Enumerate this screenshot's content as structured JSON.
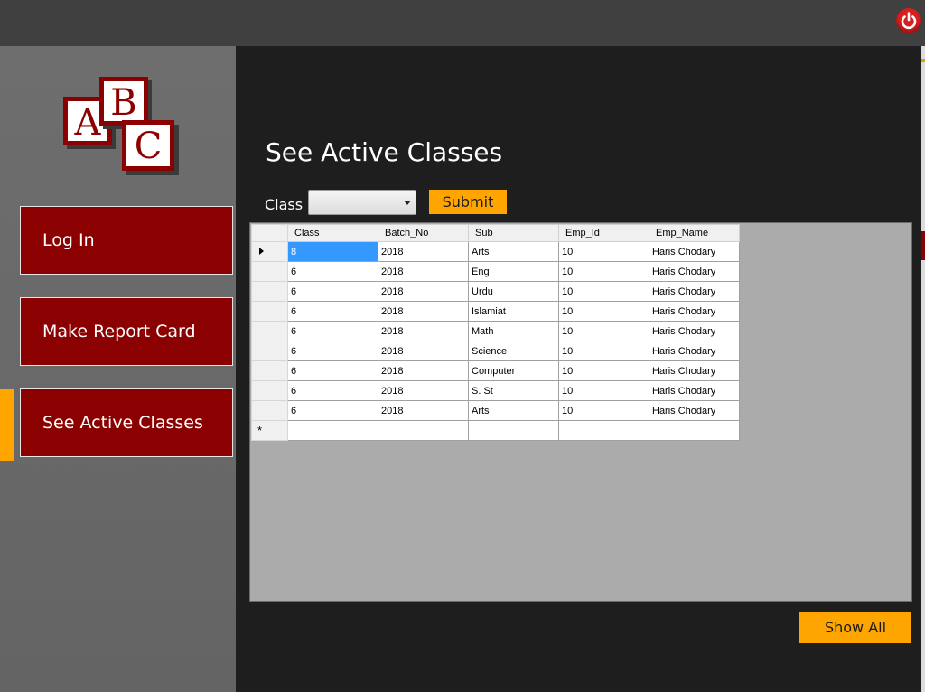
{
  "window": {
    "power_icon": "power-icon",
    "power_color": "#d81f1f"
  },
  "logo": {
    "letters": [
      "A",
      "B",
      "C"
    ],
    "color": "#8b0000"
  },
  "sidebar": {
    "items": [
      {
        "label": "Log In"
      },
      {
        "label": "Make Report Card"
      },
      {
        "label": "See Active Classes",
        "active": true
      }
    ],
    "accent": "#ffa500",
    "button_color": "#8b0000"
  },
  "main": {
    "title": "See Active Classes",
    "class_label": "Class",
    "class_select_value": "",
    "submit_label": "Submit",
    "show_all_label": "Show All"
  },
  "grid": {
    "columns": [
      "Class",
      "Batch_No",
      "Sub",
      "Emp_Id",
      "Emp_Name"
    ],
    "rows": [
      [
        "8",
        "2018",
        "Arts",
        "10",
        "Haris Chodary"
      ],
      [
        "6",
        "2018",
        "Eng",
        "10",
        "Haris Chodary"
      ],
      [
        "6",
        "2018",
        "Urdu",
        "10",
        "Haris Chodary"
      ],
      [
        "6",
        "2018",
        "Islamiat",
        "10",
        "Haris Chodary"
      ],
      [
        "6",
        "2018",
        "Math",
        "10",
        "Haris Chodary"
      ],
      [
        "6",
        "2018",
        "Science",
        "10",
        "Haris Chodary"
      ],
      [
        "6",
        "2018",
        "Computer",
        "10",
        "Haris Chodary"
      ],
      [
        "6",
        "2018",
        "S. St",
        "10",
        "Haris Chodary"
      ],
      [
        "6",
        "2018",
        "Arts",
        "10",
        "Haris Chodary"
      ]
    ],
    "selected_row": 0,
    "new_row_marker": "*"
  }
}
